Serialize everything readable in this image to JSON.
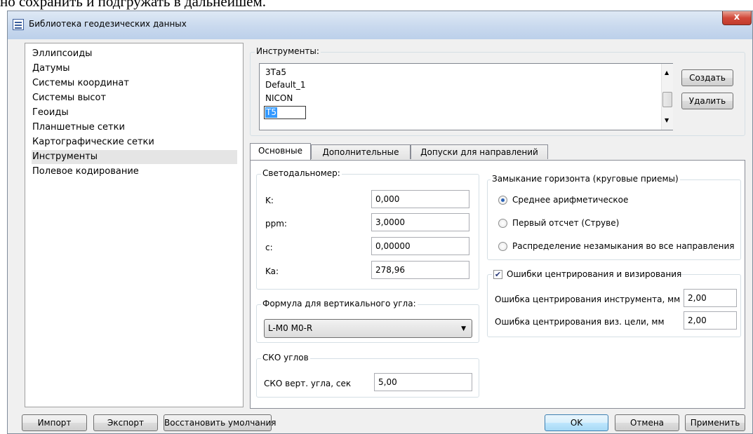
{
  "document_text": "но сохранить и подгружать в дальнейшем.",
  "window": {
    "title": "Библиотека геодезических данных",
    "close_symbol": "x"
  },
  "sidebar": {
    "items": [
      {
        "label": "Эллипсоиды"
      },
      {
        "label": "Датумы"
      },
      {
        "label": "Системы координат"
      },
      {
        "label": "Системы высот"
      },
      {
        "label": "Геоиды"
      },
      {
        "label": "Планшетные сетки"
      },
      {
        "label": "Картографические сетки"
      },
      {
        "label": "Инструменты",
        "selected": true
      },
      {
        "label": "Полевое кодирование"
      }
    ]
  },
  "instruments": {
    "group_label": "Инструменты:",
    "items": [
      {
        "label": "3Та5"
      },
      {
        "label": "Default_1"
      },
      {
        "label": "NICON"
      },
      {
        "label": "T5",
        "editing": true
      }
    ],
    "create_label": "Создать",
    "delete_label": "Удалить"
  },
  "tabs": [
    {
      "label": "Основные",
      "active": true
    },
    {
      "label": "Дополнительные"
    },
    {
      "label": "Допуски для направлений"
    }
  ],
  "rangefinder": {
    "group_label": "Светодальномер:",
    "fields": [
      {
        "label": "K:",
        "value": "0,000"
      },
      {
        "label": "ppm:",
        "value": "3,0000"
      },
      {
        "label": "c:",
        "value": "0,00000"
      },
      {
        "label": "Ka:",
        "value": "278,96"
      }
    ]
  },
  "vertical_formula": {
    "group_label": "Формула для вертикального угла:",
    "selected": "L-M0 M0-R"
  },
  "angle_rms": {
    "group_label": "СКО углов",
    "field_label": "СКО верт. угла, сек",
    "value": "5,00"
  },
  "horizon_closure": {
    "group_label": "Замыкание горизонта (круговые приемы)",
    "options": [
      {
        "label": "Среднее арифметическое",
        "selected": true
      },
      {
        "label": "Первый отсчет (Струве)",
        "selected": false
      },
      {
        "label": "Распределение незамыкания во все направления",
        "selected": false
      }
    ]
  },
  "centering_errors": {
    "checkbox_label": "Ошибки центрирования и визирования",
    "checked": true,
    "fields": [
      {
        "label": "Ошибка центрирования инструмента, мм",
        "value": "2,00"
      },
      {
        "label": "Ошибка центрирования виз. цели, мм",
        "value": "2,00"
      }
    ]
  },
  "footer": {
    "import_label": "Импорт",
    "export_label": "Экспорт",
    "restore_label": "Восстановить умолчания",
    "ok_label": "OK",
    "cancel_label": "Отмена",
    "apply_label": "Применить"
  }
}
